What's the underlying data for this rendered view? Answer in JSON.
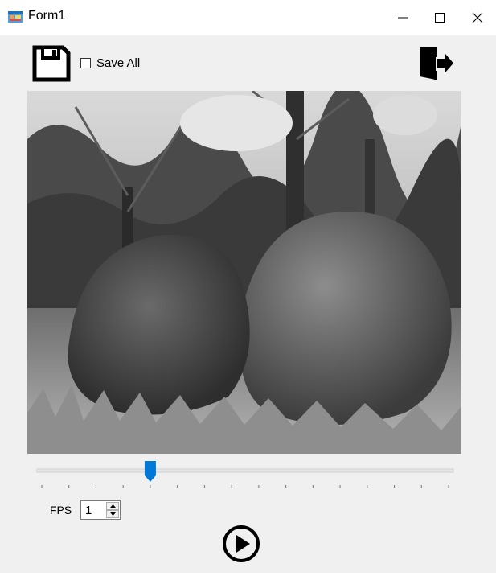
{
  "window": {
    "title": "Form1",
    "app_icon": "winforms-app-icon",
    "controls": [
      "minimize-icon",
      "maximize-icon",
      "close-icon"
    ]
  },
  "toolbar": {
    "save_icon": "floppy-disk-icon",
    "save_all_label": "Save All",
    "save_all_checked": false,
    "exit_icon": "exit-door-icon"
  },
  "picture": {
    "content": "grayscale-squirrel-photo"
  },
  "trackbar": {
    "tick_count": 16,
    "value_index": 4,
    "accent_color": "#0078d7"
  },
  "fps": {
    "label": "FPS",
    "value": "1"
  },
  "playback": {
    "play_icon": "play-circle-icon"
  }
}
